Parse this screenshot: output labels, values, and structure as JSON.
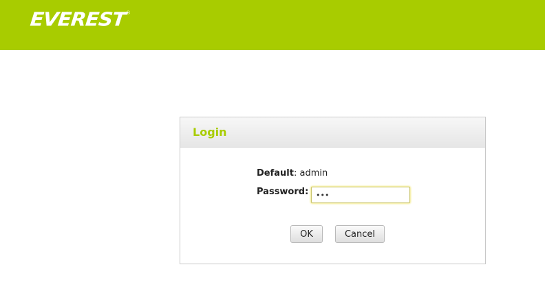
{
  "header": {
    "brand": "EVEREST",
    "brand_mark": "®",
    "brand_color": "#a8cc00"
  },
  "login": {
    "title": "Login",
    "default_label": "Default",
    "default_value": "admin",
    "password_label": "Password",
    "password_value": "•••",
    "ok_label": "OK",
    "cancel_label": "Cancel"
  }
}
